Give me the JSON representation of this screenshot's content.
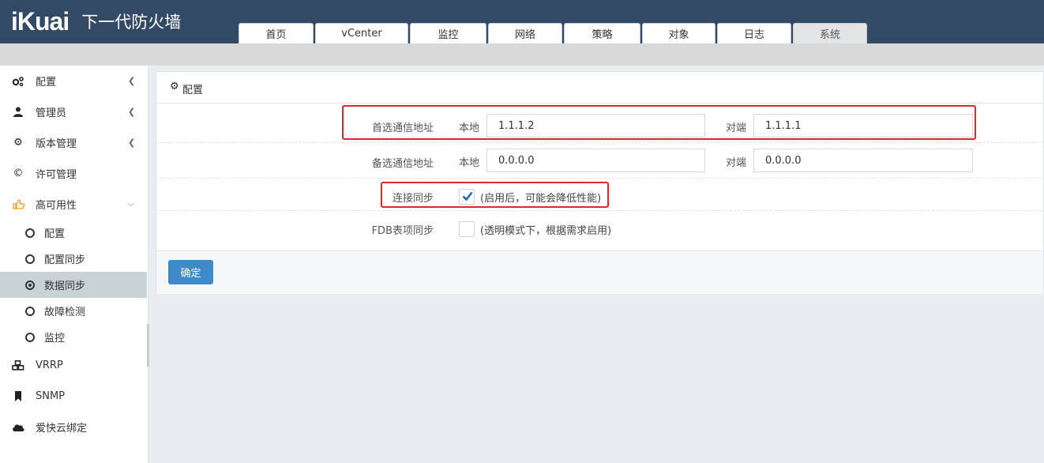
{
  "header": {
    "logo": "iKuai",
    "title": "下一代防火墙",
    "tabs": [
      {
        "label": "首页",
        "active": false
      },
      {
        "label": "vCenter",
        "active": false
      },
      {
        "label": "监控",
        "active": false
      },
      {
        "label": "网络",
        "active": false
      },
      {
        "label": "策略",
        "active": false
      },
      {
        "label": "对象",
        "active": false
      },
      {
        "label": "日志",
        "active": false
      },
      {
        "label": "系统",
        "active": true
      }
    ]
  },
  "sidebar": {
    "items": [
      {
        "label": "配置",
        "icon": "gears-icon"
      },
      {
        "label": "管理员",
        "icon": "user-icon"
      },
      {
        "label": "版本管理",
        "icon": "gear-icon"
      },
      {
        "label": "许可管理",
        "icon": "copyright-icon"
      },
      {
        "label": "高可用性",
        "icon": "thumbs-up-icon"
      },
      {
        "label": "VRRP",
        "icon": "cubes-icon"
      },
      {
        "label": "SNMP",
        "icon": "bookmark-icon"
      },
      {
        "label": "爱快云绑定",
        "icon": "cloud-icon"
      }
    ],
    "subitems": [
      {
        "label": "配置",
        "active": false
      },
      {
        "label": "配置同步",
        "active": false
      },
      {
        "label": "数据同步",
        "active": true
      },
      {
        "label": "故障检测",
        "active": false
      },
      {
        "label": "监控",
        "active": false
      }
    ]
  },
  "panel": {
    "title": "配置",
    "primary": {
      "label": "首选通信地址",
      "local_label": "本地",
      "local_value": "1.1.1.2",
      "peer_label": "对端",
      "peer_value": "1.1.1.1"
    },
    "backup": {
      "label": "备选通信地址",
      "local_label": "本地",
      "local_value": "0.0.0.0",
      "peer_label": "对端",
      "peer_value": "0.0.0.0"
    },
    "conn_sync": {
      "label": "连接同步",
      "checked": true,
      "hint": "(启用后，可能会降低性能)"
    },
    "fdb_sync": {
      "label": "FDB表项同步",
      "checked": false,
      "hint": "(透明模式下，根据需求启用)"
    },
    "confirm": "确定"
  },
  "colors": {
    "header_bg": "#334a66",
    "accent": "#3d8cc9",
    "highlight_box": "#e0282b",
    "sidebar_active": "#c8d3d8"
  }
}
